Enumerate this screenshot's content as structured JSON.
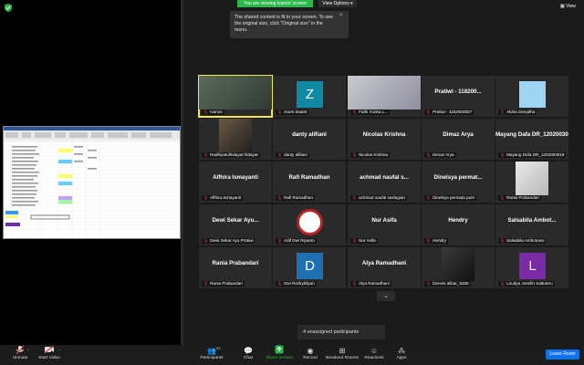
{
  "screen_share": {
    "banner": "You are viewing Ivanos' screen",
    "view_options": "View Options",
    "tooltip": "The shared content is fit to your screen. To see the original size, click \"Original size\" in the menu.",
    "tooltip_close": "×",
    "view_label": "View"
  },
  "colors": {
    "banner": "#2eb84b",
    "leave": "#0e72ed",
    "active_speaker": "#f4e94a"
  },
  "participants": [
    {
      "name": "Ivanos",
      "label_kind": "video"
    },
    {
      "name": "zoom baa04",
      "initial": "Z",
      "avatar_color": "#0e8aa5"
    },
    {
      "name": "Fathi Yunita L...",
      "label_kind": "video"
    },
    {
      "name": "Pratiwi - 1182003007",
      "big_name": "Pratiwi - 118200..."
    },
    {
      "name": "Aldira Desqitha",
      "avatar_color": "#9ed4f4"
    },
    {
      "name": "Radhiyatulhidayat hidayat",
      "label_kind": "photo"
    },
    {
      "name": "danty alifiani",
      "big_name": "danty alifiani"
    },
    {
      "name": "Nicolas Krishna",
      "big_name": "Nicolas Krishna"
    },
    {
      "name": "Dimaz Arya",
      "big_name": "Dimaz Arya"
    },
    {
      "name": "Mayang Dafa DR_1202003018",
      "big_name": "Mayang Dafa DR_1202003018"
    },
    {
      "name": "Alfhira Ismayanti",
      "big_name": "Alfhira Ismayanti"
    },
    {
      "name": "Rafi Ramadhan",
      "big_name": "Rafi Ramadhan"
    },
    {
      "name": "achmad naufal saslagian",
      "big_name": "achmad naufal s..."
    },
    {
      "name": "Dinelsya permata putri",
      "big_name": "Dinelsya permat..."
    },
    {
      "name": "Rania Prabandari",
      "label_kind": "photo"
    },
    {
      "name": "Dewi Sekar Ayu Pratiwi",
      "big_name": "Dewi Sekar Ayu..."
    },
    {
      "name": "Adif Dwi Riyanto",
      "label_kind": "logo"
    },
    {
      "name": "Nur Asifa",
      "big_name": "Nur Asifa"
    },
    {
      "name": "Hendry",
      "big_name": "Hendry"
    },
    {
      "name": "Salsabila Ambotuwo",
      "big_name": "Salsabila Ambot..."
    },
    {
      "name": "Rania Prabandari",
      "big_name": "Rania Prabandari"
    },
    {
      "name": "Dwi Rezkybilyan",
      "initial": "D",
      "avatar_color": "#1f6fb3"
    },
    {
      "name": "Alya Ramadhani",
      "big_name": "Alya Ramadhani"
    },
    {
      "name": "Dennis alibar_5335",
      "label_kind": "photo"
    },
    {
      "name": "Loudya Josefin Saltuteru",
      "initial": "L",
      "avatar_color": "#7b2aa6"
    }
  ],
  "page_down": "⌄",
  "unassigned": "4 unassigned participants",
  "toolbar": {
    "unmute": "Unmute",
    "start_video": "Start Video",
    "participants": "Participants",
    "participants_count": "33",
    "chat": "Chat",
    "share_screen": "Share Screen",
    "record": "Record",
    "breakout_rooms": "Breakout Rooms",
    "reactions": "Reactions",
    "apps": "Apps",
    "leave": "Leave Room"
  },
  "icons": {
    "mic_muted": "mic-off-icon",
    "video_off": "video-off-icon",
    "participants": "people-icon",
    "chat": "chat-icon",
    "share": "share-screen-icon",
    "record": "record-icon",
    "breakout": "breakout-rooms-icon",
    "reactions": "smiley-icon",
    "apps": "apps-icon"
  }
}
